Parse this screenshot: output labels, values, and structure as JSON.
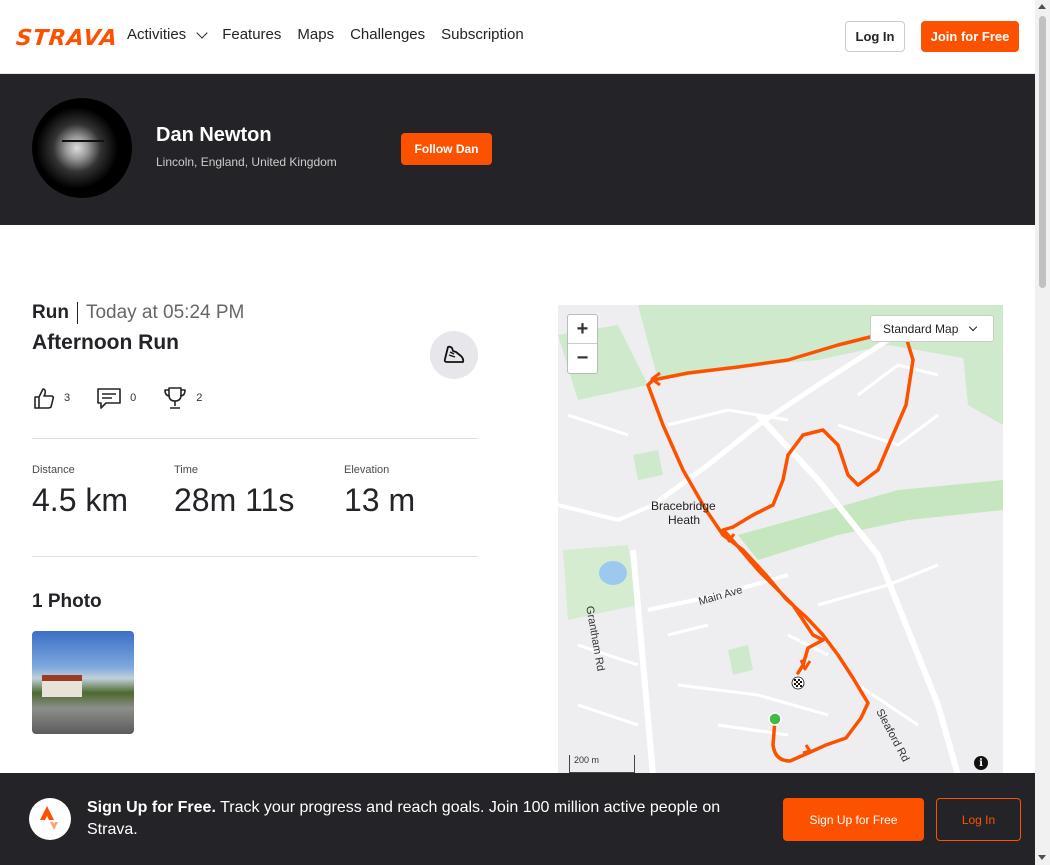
{
  "nav": {
    "logo": "STRAVA",
    "items": [
      {
        "label": "Activities",
        "has_dropdown": true
      },
      {
        "label": "Features"
      },
      {
        "label": "Maps"
      },
      {
        "label": "Challenges"
      },
      {
        "label": "Subscription"
      }
    ],
    "login_label": "Log In",
    "join_label": "Join for Free"
  },
  "athlete": {
    "name": "Dan Newton",
    "location": "Lincoln, England, United Kingdom",
    "follow_label": "Follow Dan"
  },
  "activity": {
    "type": "Run",
    "date": "Today at 05:24 PM",
    "name": "Afternoon Run",
    "kudos_count": "3",
    "comments_count": "0",
    "achievements_count": "2",
    "stats": [
      {
        "label": "Distance",
        "value": "4.5 km"
      },
      {
        "label": "Time",
        "value": "28m 11s"
      },
      {
        "label": "Elevation",
        "value": "13 m"
      }
    ],
    "photos_title": "1 Photo"
  },
  "map": {
    "zoom_in": "+",
    "zoom_out": "−",
    "map_type": "Standard Map",
    "scale_label": "200 m",
    "info": "i",
    "labels": {
      "bracebridge_1": "Bracebridge",
      "bracebridge_2": "Heath",
      "grantham_rd": "Grantham Rd",
      "main_ave": "Main Ave",
      "sleaford_rd": "Sleaford Rd"
    },
    "route_color": "#fc5200"
  },
  "banner": {
    "title": "Sign Up for Free.",
    "text": "Track your progress and reach goals. Join 100 million active people on Strava.",
    "signup_label": "Sign Up for Free",
    "login_label": "Log In"
  },
  "colors": {
    "brand": "#fc5200",
    "dark": "#242428"
  }
}
